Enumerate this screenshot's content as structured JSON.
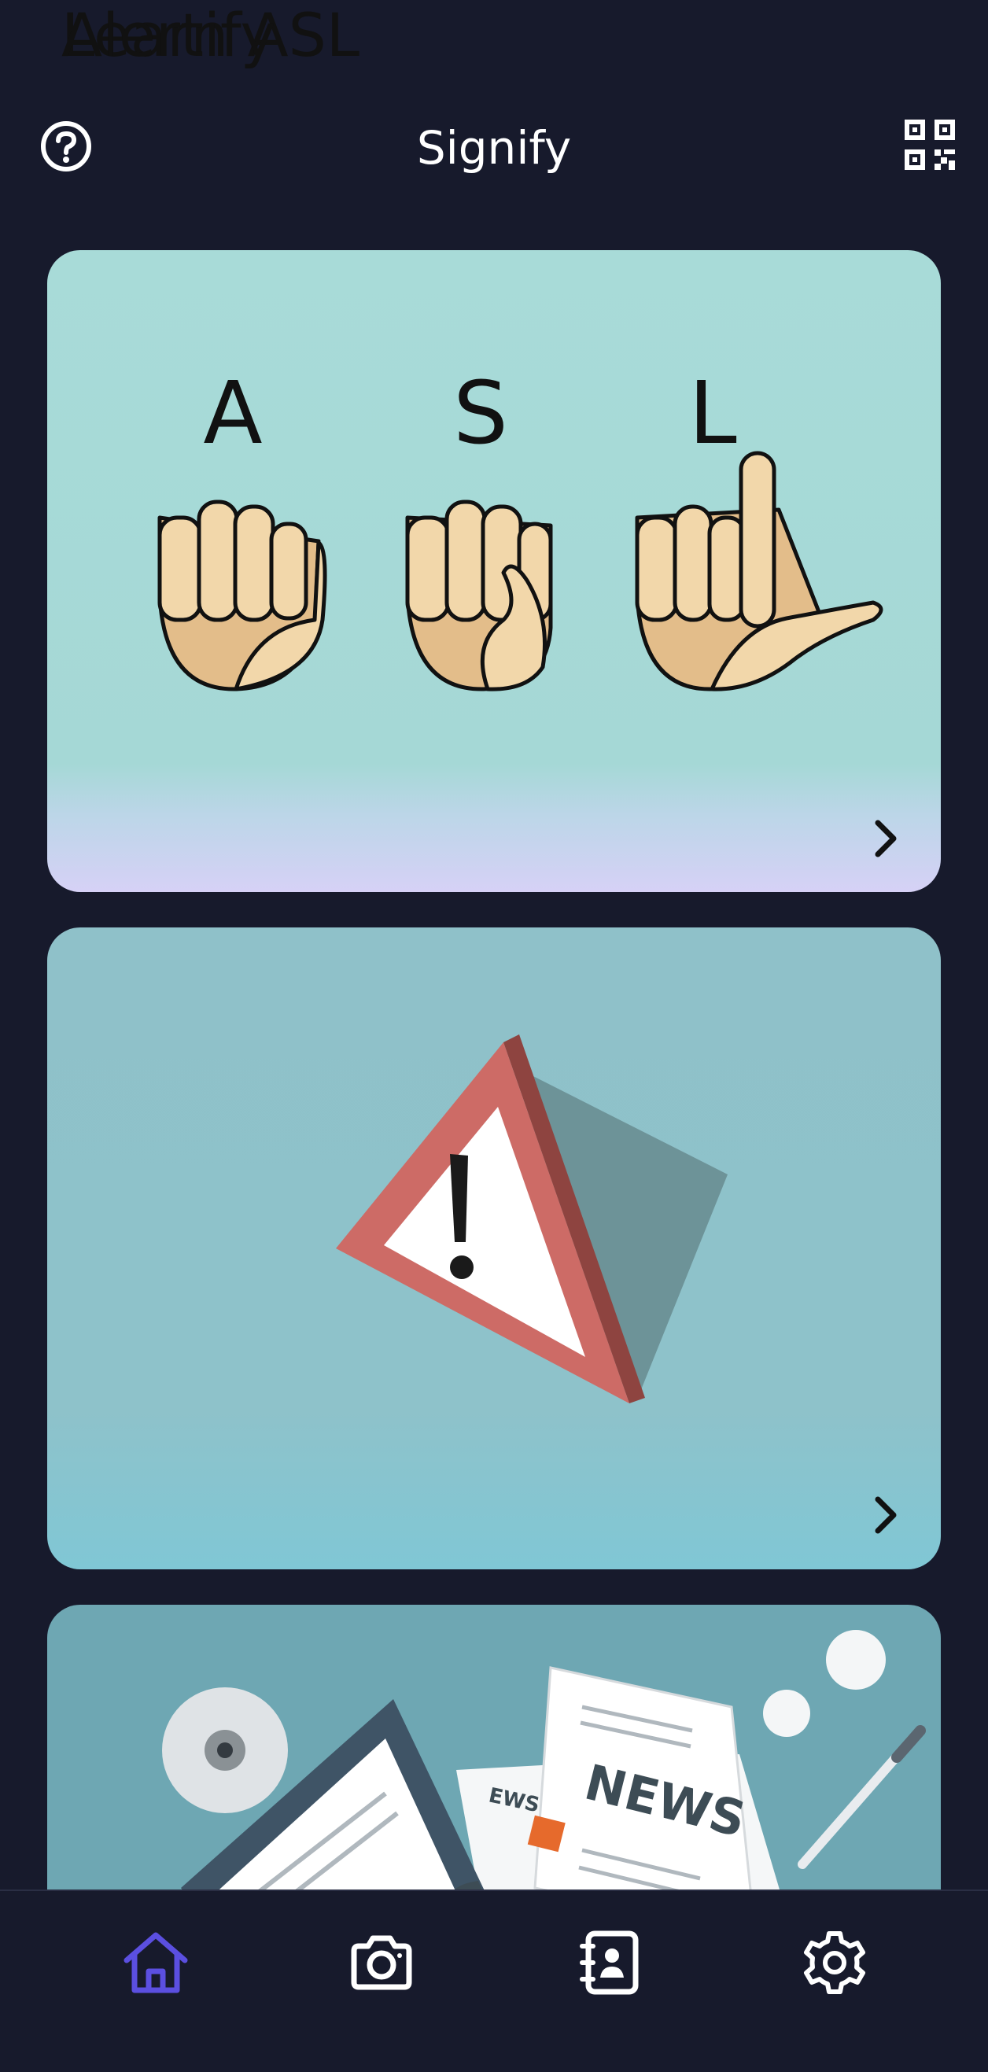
{
  "header": {
    "title": "Signify",
    "help_icon": "help-circle-icon",
    "qr_icon": "qr-code-icon"
  },
  "cards": [
    {
      "label": "Learn ASL",
      "art_letters": [
        "A",
        "S",
        "L"
      ],
      "chevron_icon": "chevron-right-icon"
    },
    {
      "label": "Alertify",
      "chevron_icon": "chevron-right-icon"
    },
    {
      "art_text": [
        "NEWS",
        "NEWS",
        "EWS"
      ]
    }
  ],
  "bottom_nav": {
    "items": [
      {
        "icon": "home-icon",
        "active": true
      },
      {
        "icon": "camera-icon",
        "active": false
      },
      {
        "icon": "contacts-book-icon",
        "active": false
      },
      {
        "icon": "settings-gear-icon",
        "active": false
      }
    ],
    "active_color": "#5b4fe0",
    "inactive_color": "#ffffff"
  },
  "colors": {
    "background": "#171a2c",
    "card_asl": "#a8dbd8",
    "card_alert": "#8fc1c9",
    "card_news": "#6ea7b3"
  }
}
